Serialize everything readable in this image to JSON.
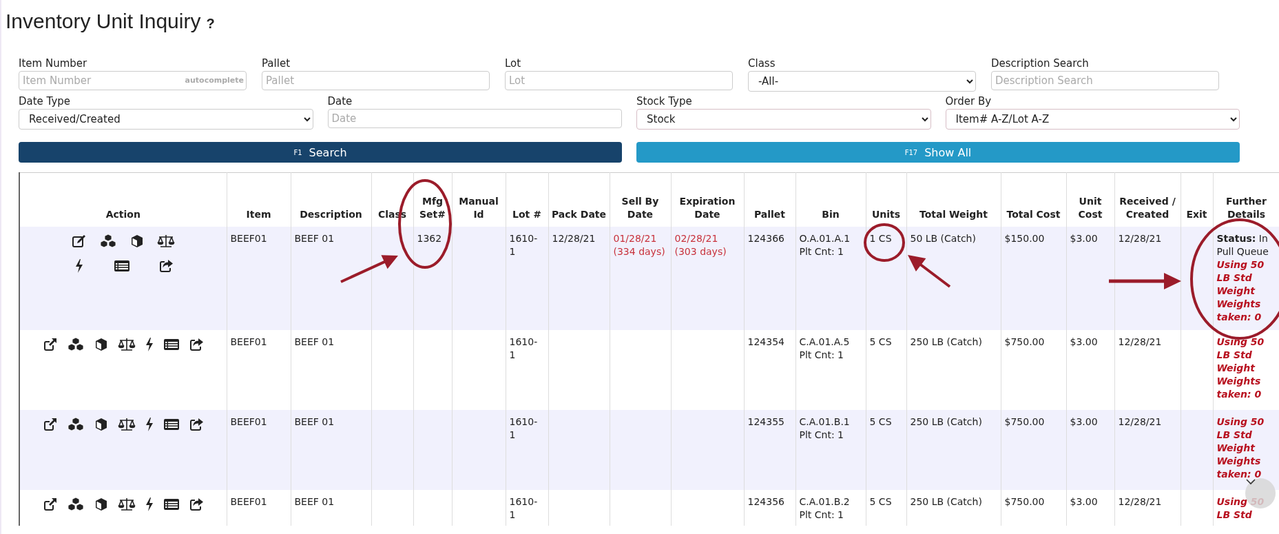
{
  "page": {
    "title": "Inventory Unit Inquiry",
    "help": "?"
  },
  "filters": [
    {
      "kind": "text",
      "label": "Item Number",
      "placeholder": "Item Number",
      "hint": "autocomplete"
    },
    {
      "kind": "text",
      "label": "Pallet",
      "placeholder": "Pallet"
    },
    {
      "kind": "text",
      "label": "Lot",
      "placeholder": "Lot"
    },
    {
      "kind": "select",
      "label": "Class",
      "value": "-All-"
    },
    {
      "kind": "text",
      "label": "Description Search",
      "placeholder": "Description Search"
    },
    {
      "kind": "select",
      "label": "Date Type",
      "value": "Received/Created"
    },
    {
      "kind": "text",
      "label": "Date",
      "placeholder": "Date"
    },
    {
      "kind": "select",
      "label": "Stock Type",
      "value": "Stock"
    },
    {
      "kind": "select",
      "label": "Order By",
      "value": "Item# A-Z/Lot A-Z"
    }
  ],
  "buttons": [
    {
      "kind": "primary",
      "key": "F1",
      "label": "Search"
    },
    {
      "kind": "secondary",
      "key": "F17",
      "label": "Show All"
    }
  ],
  "table": {
    "columns": [
      {
        "kind": "actions",
        "label": "Action"
      },
      {
        "kind": "plain",
        "label": "Item"
      },
      {
        "kind": "plain",
        "label": "Description"
      },
      {
        "kind": "plain",
        "label": "Class"
      },
      {
        "kind": "plain",
        "label": "Mfg Set#"
      },
      {
        "kind": "plain",
        "label": "Manual Id"
      },
      {
        "kind": "plain",
        "label": "Lot #"
      },
      {
        "kind": "plain",
        "label": "Pack Date"
      },
      {
        "kind": "alert",
        "label": "Sell By Date"
      },
      {
        "kind": "alert",
        "label": "Expiration Date"
      },
      {
        "kind": "plain",
        "label": "Pallet"
      },
      {
        "kind": "bin",
        "label": "Bin"
      },
      {
        "kind": "plain",
        "label": "Units"
      },
      {
        "kind": "plain",
        "label": "Total Weight"
      },
      {
        "kind": "plain",
        "label": "Total Cost"
      },
      {
        "kind": "plain",
        "label": "Unit Cost"
      },
      {
        "kind": "plain",
        "label": "Received / Created"
      },
      {
        "kind": "plain",
        "label": "Exit"
      },
      {
        "kind": "details",
        "label": "Further Details"
      }
    ],
    "rows": [
      {
        "kind": "queued",
        "item": "BEEF01",
        "description": "BEEF 01",
        "mfg_set": "1362",
        "lot": "1610-1",
        "pack_date": "12/28/21",
        "sell_by": "01/28/21 (334 days)",
        "expiration": "02/28/21 (303 days)",
        "pallet": "124366",
        "bin": "O.A.01.A.1",
        "bin_count": "Plt Cnt: 1",
        "units": "1 CS",
        "total_weight": "50 LB (Catch)",
        "total_cost": "$150.00",
        "unit_cost": "$3.00",
        "received": "12/28/21",
        "status": "**Status:** In Pull Queue",
        "notes": [
          "Using 50 LB Std Weight",
          "Weights taken: 0"
        ]
      },
      {
        "kind": "stock",
        "item": "BEEF01",
        "description": "BEEF 01",
        "lot": "1610-1",
        "pallet": "124354",
        "bin": "C.A.01.A.5",
        "bin_count": "Plt Cnt: 1",
        "units": "5 CS",
        "total_weight": "250 LB (Catch)",
        "total_cost": "$750.00",
        "unit_cost": "$3.00",
        "received": "12/28/21",
        "notes": [
          "Using 50 LB Std Weight",
          "Weights taken: 0"
        ]
      },
      {
        "kind": "stock",
        "item": "BEEF01",
        "description": "BEEF 01",
        "lot": "1610-1",
        "pallet": "124355",
        "bin": "C.A.01.B.1",
        "bin_count": "Plt Cnt: 1",
        "units": "5 CS",
        "total_weight": "250 LB (Catch)",
        "total_cost": "$750.00",
        "unit_cost": "$3.00",
        "received": "12/28/21",
        "notes": [
          "Using 50 LB Std Weight",
          "Weights taken: 0"
        ]
      },
      {
        "kind": "stock",
        "item": "BEEF01",
        "description": "BEEF 01",
        "lot": "1610-1",
        "pallet": "124356",
        "bin": "C.A.01.B.2",
        "bin_count": "Plt Cnt: 1",
        "units": "5 CS",
        "total_weight": "250 LB (Catch)",
        "total_cost": "$750.00",
        "unit_cost": "$3.00",
        "received": "12/28/21",
        "notes": [
          "Using 50 LB Std"
        ]
      }
    ]
  }
}
